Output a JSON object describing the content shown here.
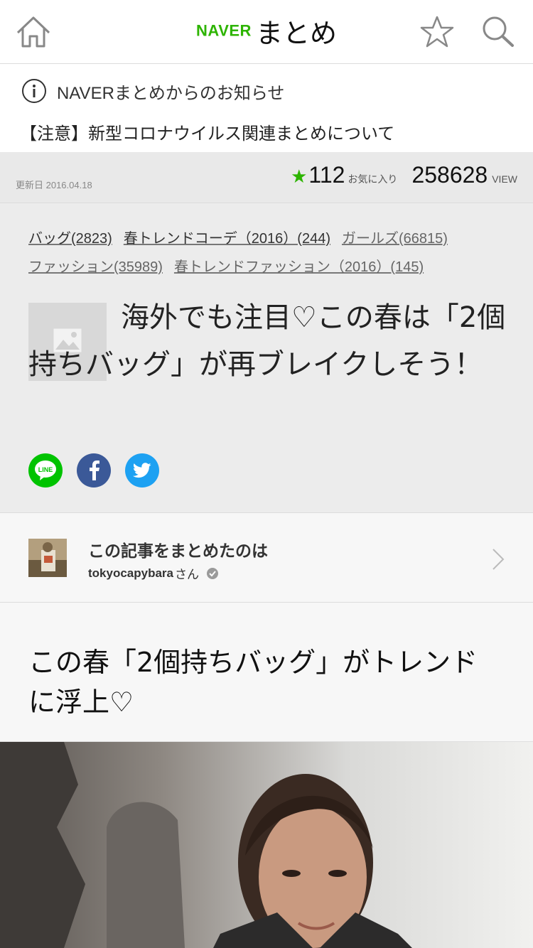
{
  "header": {
    "logo_brand": "NAVER",
    "logo_text": "まとめ",
    "icons": [
      "home-icon",
      "star-icon",
      "search-icon"
    ]
  },
  "notice": {
    "title": "NAVERまとめからのお知らせ",
    "link": "【注意】新型コロナウイルス関連まとめについて"
  },
  "stats": {
    "updated": "更新日 2016.04.18",
    "fav_count": "112",
    "fav_label": "お気に入り",
    "view_count": "258628",
    "view_label": "VIEW"
  },
  "article": {
    "tags": [
      {
        "label": "バッグ(2823)"
      },
      {
        "label": "春トレンドコーデ（2016）(244)"
      },
      {
        "label": "ガールズ(66815)"
      },
      {
        "label": "ファッション(35989)"
      },
      {
        "label": "春トレンドファッション（2016）(145)"
      }
    ],
    "title": "海外でも注目♡この春は「2個持ちバッグ」が再ブレイクしそう！",
    "share": {
      "line": "LINE"
    }
  },
  "author": {
    "heading": "この記事をまとめたのは",
    "name": "tokyocapybara",
    "suffix": "さん"
  },
  "section": {
    "heading": "この春「2個持ちバッグ」がトレンドに浮上♡"
  },
  "colors": {
    "brand": "#2db400",
    "line": "#00c300",
    "facebook": "#3b5998",
    "twitter": "#1da1f2"
  }
}
